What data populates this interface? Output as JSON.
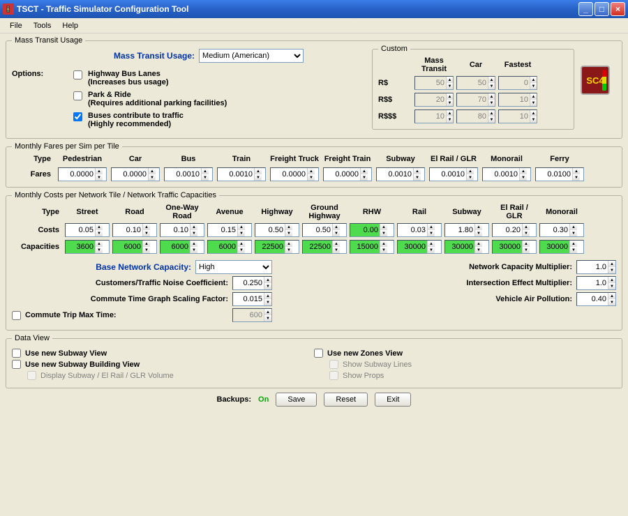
{
  "window": {
    "title": "TSCT - Traffic Simulator Configuration Tool"
  },
  "menu": {
    "file": "File",
    "tools": "Tools",
    "help": "Help"
  },
  "mtu": {
    "legend": "Mass Transit Usage",
    "label": "Mass Transit Usage:",
    "selected": "Medium (American)",
    "options_label": "Options:",
    "opt1": "Highway Bus Lanes",
    "opt1s": "(Increases bus usage)",
    "opt2": "Park & Ride",
    "opt2s": "(Requires additional parking facilities)",
    "opt3": "Buses contribute to traffic",
    "opt3s": "(Highly recommended)",
    "custom": {
      "title": "Custom",
      "h_mt": "Mass Transit",
      "h_car": "Car",
      "h_fast": "Fastest",
      "r1": "R$",
      "r2": "R$$",
      "r3": "R$$$",
      "v": {
        "a1": "50",
        "a2": "50",
        "a3": "0",
        "b1": "20",
        "b2": "70",
        "b3": "10",
        "c1": "10",
        "c2": "80",
        "c3": "10"
      }
    }
  },
  "fares": {
    "legend": "Monthly Fares per Sim per Tile",
    "type": "Type",
    "row": "Fares",
    "cols": [
      "Pedestrian",
      "Car",
      "Bus",
      "Train",
      "Freight Truck",
      "Freight Train",
      "Subway",
      "El Rail / GLR",
      "Monorail",
      "Ferry"
    ],
    "v": [
      "0.0000",
      "0.0000",
      "0.0010",
      "0.0010",
      "0.0000",
      "0.0000",
      "0.0010",
      "0.0010",
      "0.0010",
      "0.0100"
    ]
  },
  "costs": {
    "legend": "Monthly Costs per Network Tile / Network Traffic Capacities",
    "type": "Type",
    "r_cost": "Costs",
    "r_cap": "Capacities",
    "cols": [
      "Street",
      "Road",
      "One-Way Road",
      "Avenue",
      "Highway",
      "Ground Highway",
      "RHW",
      "Rail",
      "Subway",
      "El Rail / GLR",
      "Monorail"
    ],
    "cost_v": [
      "0.05",
      "0.10",
      "0.10",
      "0.15",
      "0.50",
      "0.50",
      "0.00",
      "0.03",
      "1.80",
      "0.20",
      "0.30"
    ],
    "cap_v": [
      "3600",
      "6000",
      "6000",
      "6000",
      "22500",
      "22500",
      "15000",
      "30000",
      "30000",
      "30000",
      "30000"
    ],
    "bnc_lbl": "Base Network Capacity:",
    "bnc_sel": "High",
    "p1": "Customers/Traffic Noise Coefficient:",
    "p1v": "0.250",
    "p2": "Commute Time Graph Scaling Factor:",
    "p2v": "0.015",
    "p3": "Commute Trip Max Time:",
    "p3v": "600",
    "p4": "Network Capacity Multiplier:",
    "p4v": "1.0",
    "p5": "Intersection Effect Multiplier:",
    "p5v": "1.0",
    "p6": "Vehicle Air Pollution:",
    "p6v": "0.40"
  },
  "dataview": {
    "legend": "Data View",
    "a": "Use new Subway View",
    "b": "Use new Subway Building View",
    "c": "Display Subway / El Rail / GLR Volume",
    "d": "Use new Zones View",
    "e": "Show Subway Lines",
    "f": "Show Props"
  },
  "bottom": {
    "backups": "Backups:",
    "on": "On",
    "save": "Save",
    "reset": "Reset",
    "exit": "Exit"
  }
}
